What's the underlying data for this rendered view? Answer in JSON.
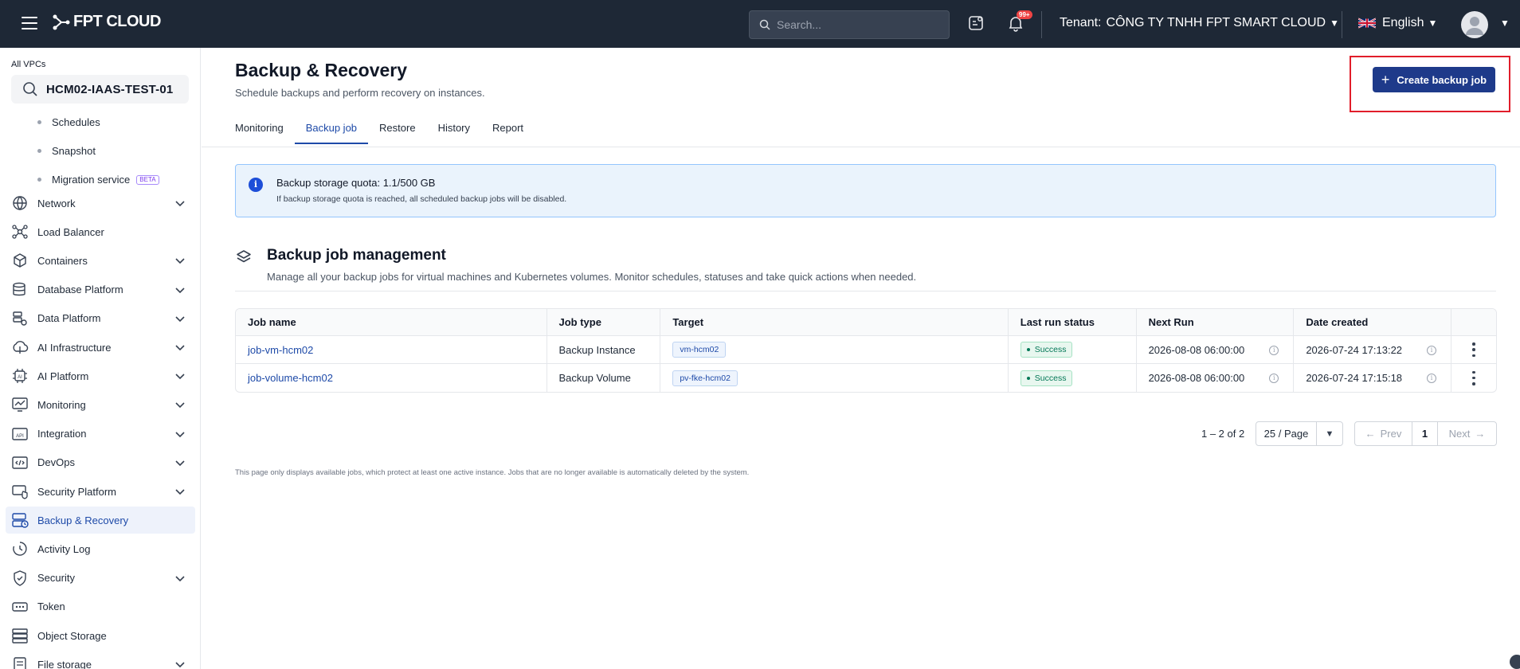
{
  "header": {
    "brand": "FPT CLOUD",
    "search_placeholder": "Search...",
    "notification_badge": "99+",
    "tenant_label": "Tenant:",
    "tenant_name": "CÔNG TY TNHH FPT SMART CLOUD",
    "language": "English"
  },
  "sidebar": {
    "vpc_label": "All VPCs",
    "vpc_name": "HCM02-IAAS-TEST-01",
    "sub_items": [
      {
        "label": "Schedules"
      },
      {
        "label": "Snapshot"
      },
      {
        "label": "Migration service",
        "badge": "BETA"
      }
    ],
    "items": [
      {
        "label": "Network",
        "icon": "globe-icon"
      },
      {
        "label": "Load Balancer",
        "icon": "load-balancer-icon"
      },
      {
        "label": "Containers",
        "icon": "cube-icon"
      },
      {
        "label": "Database Platform",
        "icon": "database-icon"
      },
      {
        "label": "Data Platform",
        "icon": "data-platform-icon"
      },
      {
        "label": "AI Infrastructure",
        "icon": "ai-infrastructure-icon"
      },
      {
        "label": "AI Platform",
        "icon": "ai-chip-icon"
      },
      {
        "label": "Monitoring",
        "icon": "monitor-chart-icon"
      },
      {
        "label": "Integration",
        "icon": "api-icon"
      },
      {
        "label": "DevOps",
        "icon": "code-icon"
      },
      {
        "label": "Security Platform",
        "icon": "security-platform-icon"
      },
      {
        "label": "Backup & Recovery",
        "icon": "backup-icon"
      },
      {
        "label": "Activity Log",
        "icon": "clock-icon"
      },
      {
        "label": "Security",
        "icon": "shield-icon"
      },
      {
        "label": "Token",
        "icon": "token-icon"
      },
      {
        "label": "Object Storage",
        "icon": "storage-icon"
      },
      {
        "label": "File storage",
        "icon": "file-storage-icon"
      }
    ]
  },
  "main": {
    "title": "Backup & Recovery",
    "subtitle": "Schedule backups and perform recovery on instances.",
    "create_button": "Create backup job",
    "tabs": [
      {
        "label": "Monitoring"
      },
      {
        "label": "Backup job"
      },
      {
        "label": "Restore"
      },
      {
        "label": "History"
      },
      {
        "label": "Report"
      }
    ],
    "active_tab": "Backup job",
    "info": {
      "title": "Backup storage quota: 1.1/500 GB",
      "description": "If backup storage quota is reached, all scheduled backup jobs will be disabled."
    },
    "section": {
      "title": "Backup job management",
      "description": "Manage all your backup jobs for virtual machines and Kubernetes volumes. Monitor schedules, statuses and take quick actions when needed."
    },
    "table": {
      "columns": [
        "Job name",
        "Job type",
        "Target",
        "Last run status",
        "Next Run",
        "Date created"
      ],
      "rows": [
        {
          "job_name": "job-vm-hcm02",
          "job_type": "Backup Instance",
          "target": "vm-hcm02",
          "status": "Success",
          "next_run": "2026-08-08 06:00:00",
          "date_created": "2026-07-24 17:13:22"
        },
        {
          "job_name": "job-volume-hcm02",
          "job_type": "Backup Volume",
          "target": "pv-fke-hcm02",
          "status": "Success",
          "next_run": "2026-08-08 06:00:00",
          "date_created": "2026-07-24 17:15:18"
        }
      ]
    },
    "pagination": {
      "range": "1 – 2 of 2",
      "page_size": "25 / Page",
      "prev": "Prev",
      "current_page": "1",
      "next": "Next"
    },
    "footnote": "This page only displays available jobs, which protect at least one active instance. Jobs that are no longer available is automatically deleted by the system."
  },
  "colors": {
    "topbar": "#1e2836",
    "primary": "#1e3a8a",
    "accent": "#1e4aa8",
    "highlight": "#e11d2a",
    "success": "#047857"
  }
}
